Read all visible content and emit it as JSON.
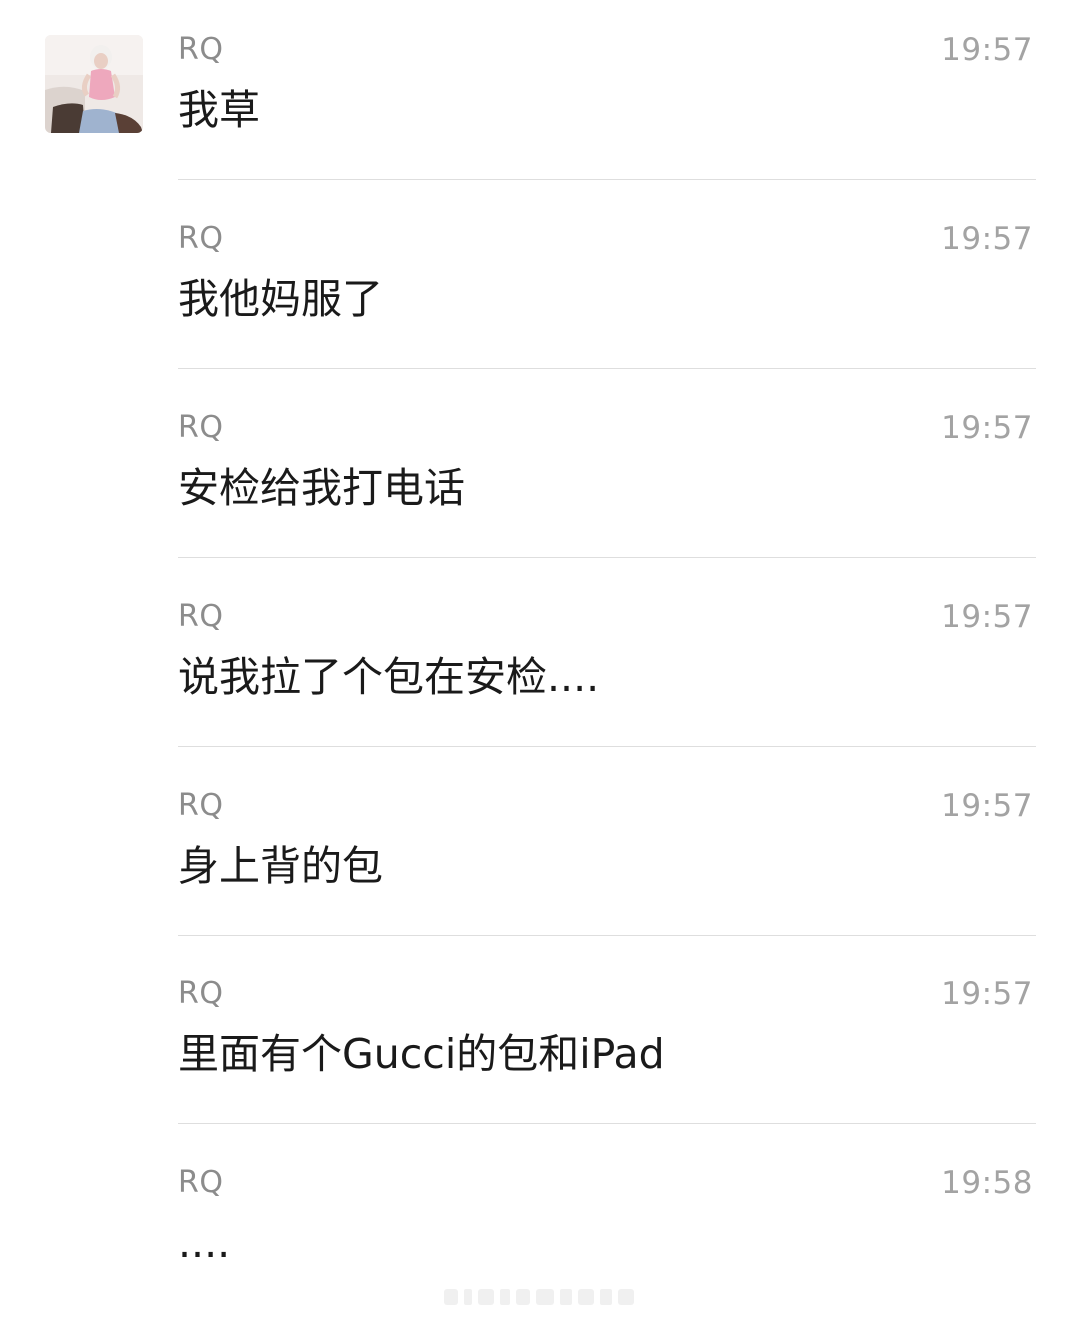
{
  "avatar": {
    "icon": "user-avatar-photo",
    "palette": {
      "background": "#efe9e6",
      "skin": "#e9cfc4",
      "hair": "#f2f0ee",
      "outfit_pink": "#eea8bd",
      "jeans": "#9fb3cf",
      "boots": "#4a3b34"
    }
  },
  "messages": [
    {
      "sender": "RQ",
      "time": "19:57",
      "text": "我草"
    },
    {
      "sender": "RQ",
      "time": "19:57",
      "text": "我他妈服了"
    },
    {
      "sender": "RQ",
      "time": "19:57",
      "text": "安检给我打电话"
    },
    {
      "sender": "RQ",
      "time": "19:57",
      "text": "说我拉了个包在安检...."
    },
    {
      "sender": "RQ",
      "time": "19:57",
      "text": "身上背的包"
    },
    {
      "sender": "RQ",
      "time": "19:57",
      "text": "里面有个Gucci的包和iPad"
    },
    {
      "sender": "RQ",
      "time": "19:58",
      "text": "...."
    }
  ],
  "colors": {
    "sender": "#8c8c8c",
    "time": "#a3a3a3",
    "text": "#1a1a1a",
    "divider": "#dedede"
  }
}
